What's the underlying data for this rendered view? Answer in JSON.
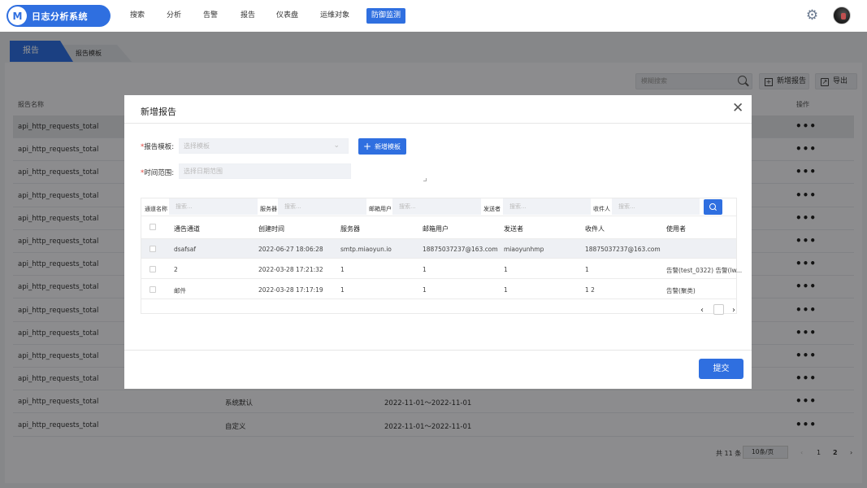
{
  "app": {
    "logo_glyph": "M",
    "title": "日志分析系统"
  },
  "nav": [
    {
      "label": "搜索"
    },
    {
      "label": "分析"
    },
    {
      "label": "告警"
    },
    {
      "label": "报告"
    },
    {
      "label": "仪表盘"
    },
    {
      "label": "运维对象"
    },
    {
      "label": "防御监测",
      "active": true
    }
  ],
  "tabs": [
    {
      "label": "报告"
    },
    {
      "label": "报告模板"
    }
  ],
  "toolbar": {
    "search_placeholder": "模糊搜索",
    "add_label": "新增报告",
    "export_label": "导出"
  },
  "report_table": {
    "headers": {
      "name": "报告名称",
      "action": "操作"
    },
    "rows": [
      {
        "name": "api_http_requests_total",
        "template": "",
        "range": ""
      },
      {
        "name": "api_http_requests_total",
        "template": "",
        "range": ""
      },
      {
        "name": "api_http_requests_total",
        "template": "",
        "range": ""
      },
      {
        "name": "api_http_requests_total",
        "template": "",
        "range": ""
      },
      {
        "name": "api_http_requests_total",
        "template": "",
        "range": ""
      },
      {
        "name": "api_http_requests_total",
        "template": "",
        "range": ""
      },
      {
        "name": "api_http_requests_total",
        "template": "",
        "range": ""
      },
      {
        "name": "api_http_requests_total",
        "template": "",
        "range": ""
      },
      {
        "name": "api_http_requests_total",
        "template": "",
        "range": ""
      },
      {
        "name": "api_http_requests_total",
        "template": "",
        "range": ""
      },
      {
        "name": "api_http_requests_total",
        "template": "",
        "range": ""
      },
      {
        "name": "api_http_requests_total",
        "template": "",
        "range": ""
      },
      {
        "name": "api_http_requests_total",
        "template": "系统默认",
        "range": "2022-11-01～2022-11-01"
      },
      {
        "name": "api_http_requests_total",
        "template": "自定义",
        "range": "2022-11-01～2022-11-01"
      }
    ],
    "action_glyph": "•••",
    "pagination": {
      "total": "共 11 条",
      "page_size": "10条/页",
      "pages": [
        "1",
        "2"
      ],
      "current": "2"
    }
  },
  "modal": {
    "title": "新增报告",
    "template_label": "报告模板:",
    "template_placeholder": "选择模板",
    "new_template_label": "新增模板",
    "range_label": "时间范围:",
    "range_placeholder": "选择日期范围",
    "filters": [
      {
        "label": "通道名称",
        "placeholder": "搜索..."
      },
      {
        "label": "服务器",
        "placeholder": "搜索..."
      },
      {
        "label": "邮箱用户",
        "placeholder": "搜索..."
      },
      {
        "label": "发送者",
        "placeholder": "搜索..."
      },
      {
        "label": "收件人",
        "placeholder": "搜索..."
      }
    ],
    "columns": [
      "通告通道",
      "创建时间",
      "服务器",
      "邮箱用户",
      "发送者",
      "收件人",
      "使用者"
    ],
    "rows": [
      [
        "dsafsaf",
        "2022-06-27 18:06:28",
        "smtp.miaoyun.io",
        "18875037237@163.com",
        "miaoyunhmp",
        "18875037237@163.com",
        ""
      ],
      [
        "2",
        "2022-03-28 17:21:32",
        "1",
        "1",
        "1",
        "1",
        "告警(test_0322) 告警(lw..."
      ],
      [
        "邮件",
        "2022-03-28 17:17:19",
        "1",
        "1",
        "1",
        "1 2",
        "告警(聚类)"
      ]
    ],
    "submit_label": "提交"
  }
}
